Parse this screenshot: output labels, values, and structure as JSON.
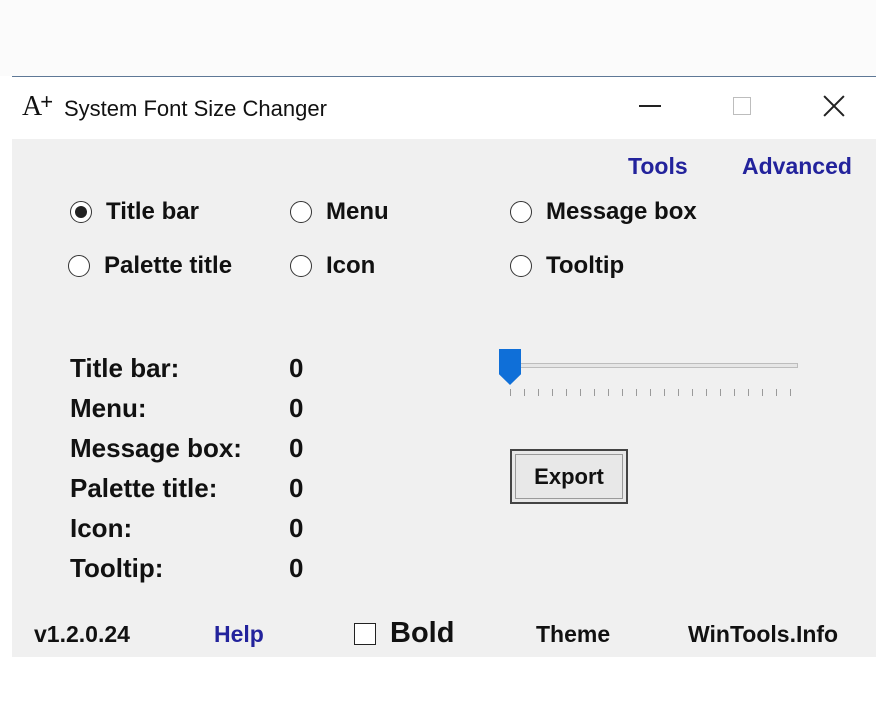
{
  "window": {
    "title": "System Font Size Changer",
    "icon": "A+"
  },
  "links": {
    "tools": "Tools",
    "advanced": "Advanced"
  },
  "options": [
    {
      "label": "Title bar",
      "selected": true
    },
    {
      "label": "Menu",
      "selected": false
    },
    {
      "label": "Message box",
      "selected": false
    },
    {
      "label": "Palette title",
      "selected": false
    },
    {
      "label": "Icon",
      "selected": false
    },
    {
      "label": "Tooltip",
      "selected": false
    }
  ],
  "sizes": [
    {
      "label": "Title bar:",
      "value": "0"
    },
    {
      "label": "Menu:",
      "value": "0"
    },
    {
      "label": "Message box:",
      "value": "0"
    },
    {
      "label": "Palette title:",
      "value": "0"
    },
    {
      "label": "Icon:",
      "value": "0"
    },
    {
      "label": "Tooltip:",
      "value": "0"
    }
  ],
  "slider": {
    "value": 0,
    "min": 0,
    "max": 20
  },
  "export_label": "Export",
  "footer": {
    "version": "v1.2.0.24",
    "help": "Help",
    "bold_label": "Bold",
    "bold_checked": false,
    "theme": "Theme",
    "site": "WinTools.Info"
  },
  "colors": {
    "link": "#23239c",
    "slider_thumb": "#0f6fd8",
    "window_bg": "#f0f0f0"
  }
}
